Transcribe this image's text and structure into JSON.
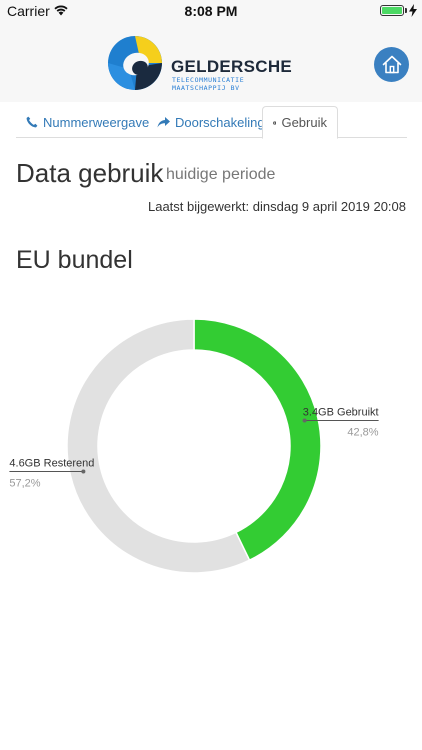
{
  "status_bar": {
    "carrier": "Carrier",
    "time": "8:08 PM",
    "battery_level": 1.0
  },
  "header": {
    "logo_name": "GELDERSCHE",
    "logo_sub_line1": "TELECOMMUNICATIE",
    "logo_sub_line2": "MAATSCHAPPIJ BV",
    "home_icon": "home-icon"
  },
  "tabs": [
    {
      "label": "Nummerweergave",
      "icon": "phone-icon",
      "active": false
    },
    {
      "label": "Doorschakeling",
      "icon": "share-arrow-icon",
      "active": false
    },
    {
      "label": "Gebruik",
      "icon": "info-circle-icon",
      "active": true
    }
  ],
  "main": {
    "title": "Data gebruik",
    "subtitle": "huidige periode",
    "last_updated": "Laatst bijgewerkt: dinsdag 9 april 2019 20:08",
    "bundle_title": "EU bundel"
  },
  "chart_data": {
    "type": "pie",
    "title": "",
    "donut": true,
    "slices": [
      {
        "label": "3.4GB Gebruikt",
        "percent_label": "42,8%",
        "value": 42.8,
        "color": "#33cc33"
      },
      {
        "label": "4.6GB Resterend",
        "percent_label": "57,2%",
        "value": 57.2,
        "color": "#e1e1e1"
      }
    ]
  },
  "colors": {
    "accent": "#337ab7",
    "home_button": "#3a80c1",
    "used": "#33cc33",
    "remaining": "#e1e1e1"
  }
}
